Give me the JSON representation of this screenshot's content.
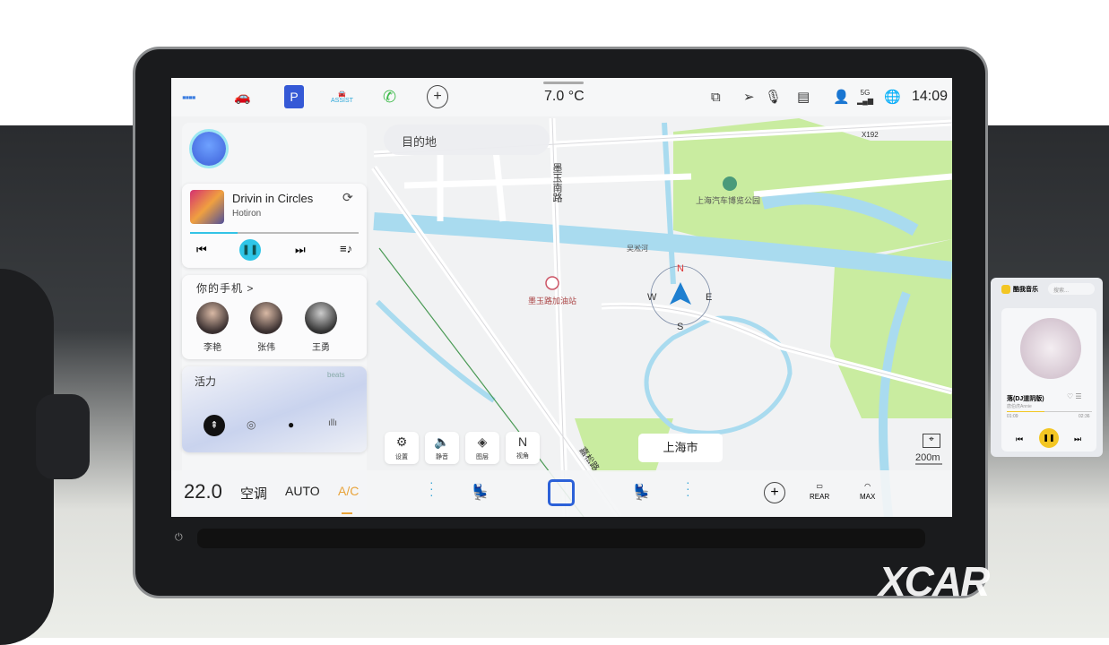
{
  "status_bar": {
    "temperature": "7.0 °C",
    "time": "14:09",
    "network": "5G",
    "parking_label": "P",
    "assist_label": "ASSIST"
  },
  "search": {
    "placeholder": "目的地"
  },
  "music": {
    "title": "Drivin in Circles",
    "artist": "Hotiron",
    "progress": 0.28
  },
  "phone": {
    "title": "你的手机",
    "contacts": [
      {
        "name": "李艳"
      },
      {
        "name": "张伟"
      },
      {
        "name": "王勇"
      }
    ]
  },
  "sound": {
    "title": "活力",
    "brand": "beats"
  },
  "map": {
    "labels": {
      "road": "墨玉南路",
      "park": "上海汽车博览公园",
      "river": "吴淞河",
      "gas_station": "墨玉路加油站",
      "road2": "嘉松路",
      "city": "上海市",
      "highway": "X192"
    },
    "compass": {
      "n": "N",
      "s": "S",
      "e": "E",
      "w": "W"
    },
    "scale": "200m"
  },
  "map_controls": [
    {
      "label": "设置",
      "icon": "gear-icon"
    },
    {
      "label": "静音",
      "icon": "speaker-mute-icon"
    },
    {
      "label": "图层",
      "icon": "layers-icon"
    },
    {
      "label": "视角",
      "icon": "N"
    }
  ],
  "climate": {
    "temperature": "22.0",
    "ac_label": "空调",
    "auto_label": "AUTO",
    "ac_toggle": "A/C",
    "rear_label": "REAR",
    "max_label": "MAX",
    "accent": "#e8a33a"
  },
  "passenger_screen": {
    "app": "酷我音乐",
    "search_placeholder": "搜索...",
    "song": "落(DJ道阴版)",
    "artist": "唐伯虎Annie",
    "elapsed": "01:09",
    "duration": "02:36",
    "accent": "#f3c623"
  },
  "watermark": "XCAR 爱卡"
}
